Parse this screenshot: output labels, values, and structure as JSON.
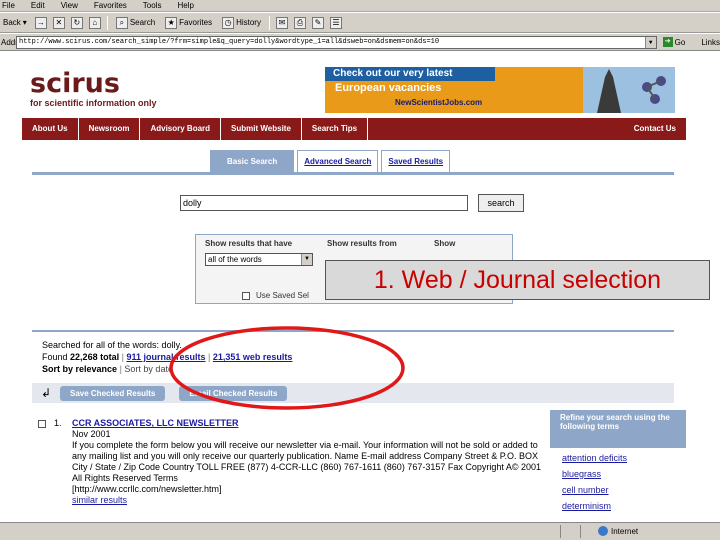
{
  "browser": {
    "menu": [
      "File",
      "Edit",
      "View",
      "Favorites",
      "Tools",
      "Help"
    ],
    "toolbar": {
      "back": "Back",
      "search": "Search",
      "favorites": "Favorites",
      "history": "History"
    },
    "address_label": "Address",
    "url": "http://www.scirus.com/search_simple/?frm=simple&q_query=dolly&wordtype_1=all&dsweb=on&dsmem=on&ds=10",
    "go_label": "Go",
    "links_label": "Links",
    "status_zone": "Internet"
  },
  "logo": {
    "name": "scirus",
    "tagline": "for scientific information only"
  },
  "banner": {
    "line1": "Check out our very latest",
    "line2": "European vacancies",
    "url": "NewScientistJobs.com"
  },
  "nav": [
    "About Us",
    "Newsroom",
    "Advisory Board",
    "Submit Website",
    "Search Tips",
    "Contact Us"
  ],
  "tabs": [
    "Basic Search",
    "Advanced Search",
    "Saved Results"
  ],
  "search": {
    "query": "dolly",
    "button": "search"
  },
  "options": {
    "label_have": "Show results that have",
    "label_from": "Show results from",
    "label_show": "Show",
    "words_select": "all of the words",
    "saved_label": "Use Saved Sel"
  },
  "callout": "1. Web / Journal selection",
  "summary": {
    "searched": "Searched for all of the words: dolly.",
    "found_prefix": "Found",
    "total": "22,268 total",
    "journal": "911 journal results",
    "web": "21,351 web results",
    "sort_prefix": "Sort by relevance",
    "sort_date": "Sort by date"
  },
  "actions": {
    "save": "Save Checked Results",
    "email": "Email Checked Results"
  },
  "result1": {
    "num": "1.",
    "title": "CCR ASSOCIATES, LLC NEWSLETTER",
    "date": "Nov 2001",
    "snippet": "If you complete the form below you will receive our newsletter via e-mail. Your information will not be sold or added to any mailing list and you will only receive our quarterly publication. Name E-mail address Company Street & P.O. BOX City / State / Zip Code Country TOLL FREE (877) 4-CCR-LLC (860) 767-1611 (860) 767-3157 Fax Copyright A© 2001 All Rights Reserved Terms",
    "url": "[http://www.ccrllc.com/newsletter.htm]",
    "similar": "similar results"
  },
  "refine": {
    "header": "Refine your search using the following terms",
    "terms": [
      "attention deficits",
      "bluegrass",
      "cell number",
      "determinism"
    ]
  },
  "colors": {
    "nav": "#8a1a1a",
    "tab": "#8ea6c8",
    "callout_text": "#c80000",
    "highlight": "#e01818"
  }
}
